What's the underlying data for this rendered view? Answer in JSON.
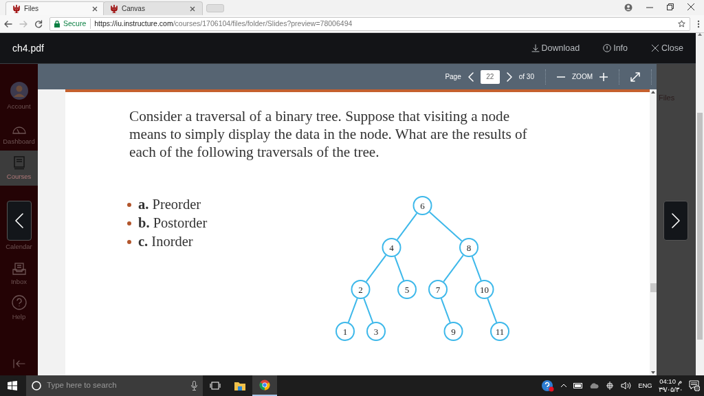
{
  "browser": {
    "tabs": [
      {
        "title": "Files",
        "selected": true
      },
      {
        "title": "Canvas",
        "selected": false
      }
    ],
    "secure_label": "Secure",
    "url_host": "https://iu.instructure.com",
    "url_path": "/courses/1706104/files/folder/Slides?preview=78006494"
  },
  "sidebar": {
    "items": [
      {
        "label": "Account",
        "kind": "avatar",
        "selected": false
      },
      {
        "label": "Dashboard",
        "kind": "dashboard",
        "selected": false
      },
      {
        "label": "Courses",
        "kind": "courses",
        "selected": true
      },
      {
        "label": "Calendar",
        "kind": "calendar",
        "selected": false
      },
      {
        "label": "Inbox",
        "kind": "inbox",
        "selected": false
      },
      {
        "label": "Help",
        "kind": "help",
        "selected": false
      }
    ]
  },
  "viewer": {
    "title": "ch4.pdf",
    "actions": [
      {
        "label": "Download",
        "kind": "download"
      },
      {
        "label": "Info",
        "kind": "info"
      },
      {
        "label": "Close",
        "kind": "close"
      }
    ],
    "toolbar": {
      "page_label": "Page",
      "page_value": "22",
      "page_total": "of 30",
      "zoom_label": "ZOOM"
    },
    "side_label": "Files"
  },
  "slide": {
    "paragraph": "Consider a traversal of a binary tree. Suppose that visiting a node means to simply display the data in the node. What are the results of each of the following traversals of the tree.",
    "bullets": [
      "**a.** Preorder",
      "**b.** Postorder",
      "**c.** Inorder"
    ],
    "tree": {
      "label": "6",
      "left": {
        "label": "4",
        "left": {
          "label": "2",
          "left": {
            "label": "1"
          },
          "right": {
            "label": "3"
          }
        },
        "right": {
          "label": "5"
        }
      },
      "right": {
        "label": "8",
        "left": {
          "label": "7",
          "right": {
            "label": "9"
          }
        },
        "right": {
          "label": "10",
          "right": {
            "label": "11"
          }
        }
      }
    }
  },
  "taskbar": {
    "search_placeholder": "Type here to search",
    "language": "ENG",
    "time": "04:10 م",
    "date": "۳۹/۰۵/۳۰"
  }
}
